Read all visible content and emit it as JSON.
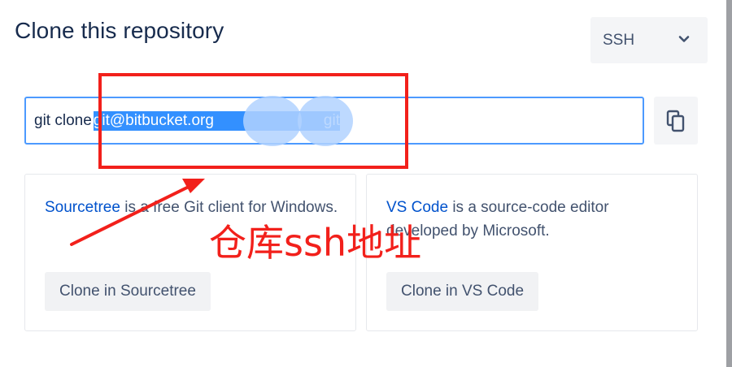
{
  "dialog": {
    "title": "Clone this repository",
    "protocol_selected": "SSH"
  },
  "clone": {
    "command_prefix": "git clone",
    "url_start": "git@bitbucket.org",
    "url_end": "git"
  },
  "icons": {
    "chevron": "chevron-down-icon",
    "copy": "copy-icon"
  },
  "cards": {
    "sourcetree": {
      "link": "Sourcetree",
      "desc": " is a free Git client for Windows.",
      "button": "Clone in Sourcetree"
    },
    "vscode": {
      "link": "VS Code",
      "desc": " is a source-code editor developed by Microsoft.",
      "button": "Clone in VS Code"
    }
  },
  "annotation": {
    "label": "仓库ssh地址",
    "color": "#f2201b"
  },
  "colors": {
    "selection": "#3390ff",
    "focus_border": "#4c9aff",
    "link": "#0052cc"
  }
}
